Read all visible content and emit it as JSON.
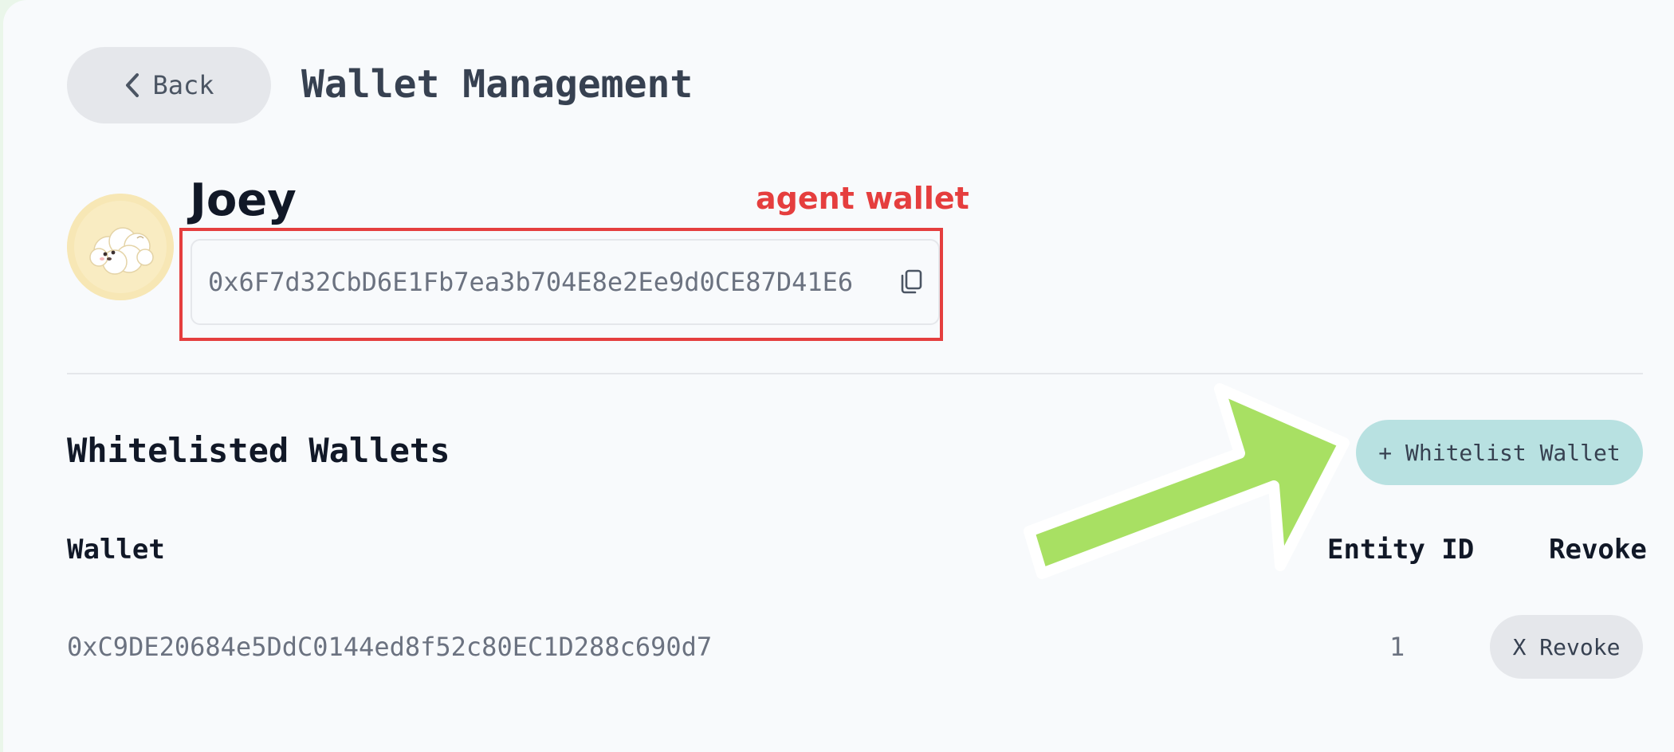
{
  "header": {
    "back_label": "Back",
    "title": "Wallet Management"
  },
  "agent": {
    "name": "Joey",
    "wallet_address": "0x6F7d32CbD6E1Fb7ea3b704E8e2Ee9d0CE87D41E6"
  },
  "annotations": {
    "agent_wallet_label": "agent wallet",
    "highlight_color": "#e53e3e",
    "arrow_color": "#a8e063"
  },
  "whitelist": {
    "section_title": "Whitelisted Wallets",
    "add_button_label": "+ Whitelist Wallet",
    "columns": [
      "Wallet",
      "Entity ID",
      "Revoke"
    ],
    "rows": [
      {
        "wallet": "0xC9DE20684e5DdC0144ed8f52c80EC1D288c690d7",
        "entity_id": "1",
        "revoke_label": "X Revoke"
      }
    ]
  },
  "icons": {
    "back": "chevron-left-icon",
    "copy": "copy-icon",
    "avatar": "fluffy-dog-avatar"
  },
  "colors": {
    "accent_button": "#b8e1e1",
    "neutral_button": "#e5e7eb",
    "page_background": "#f8fafc"
  }
}
